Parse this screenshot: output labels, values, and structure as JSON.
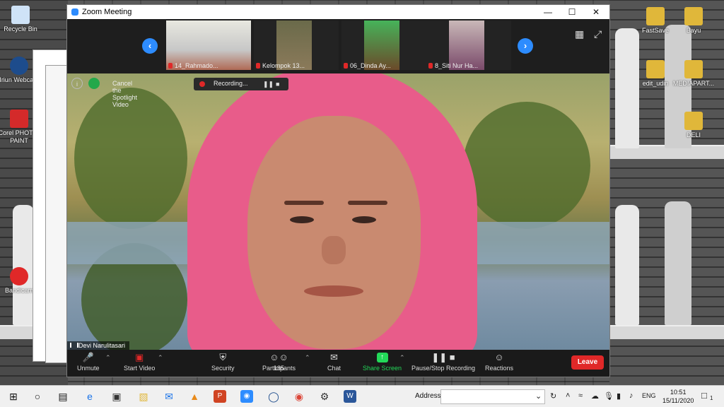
{
  "desktop": {
    "icons": [
      {
        "label": "Recycle Bin"
      },
      {
        "label": "Iriun Webcam"
      },
      {
        "label": "Corel PHOTO-PAINT"
      },
      {
        "label": "Bandicam"
      },
      {
        "label": "FastSave"
      },
      {
        "label": "Bayu"
      },
      {
        "label": "edit_udin"
      },
      {
        "label": "MEDIAPART..."
      },
      {
        "label": "DELI"
      }
    ]
  },
  "zoom": {
    "window_title": "Zoom Meeting",
    "participants": [
      {
        "name": "14_Rahmado..."
      },
      {
        "name": "Kelompok 13..."
      },
      {
        "name": "06_Dinda Ay..."
      },
      {
        "name": "8_Siti Nur Ha..."
      }
    ],
    "spotlight_label": "Cancel the Spotlight Video",
    "recording_label": "Recording...",
    "active_speaker": "Devi Narulitasari",
    "toolbar": {
      "unmute": "Unmute",
      "start_video": "Start Video",
      "security": "Security",
      "participants": "Participants",
      "participants_count": "185",
      "chat": "Chat",
      "share_screen": "Share Screen",
      "pause_stop": "Pause/Stop Recording",
      "reactions": "Reactions",
      "leave": "Leave"
    },
    "colors": {
      "accent": "#2d8cff",
      "leave": "#e02828",
      "share": "#23d959"
    }
  },
  "taskbar": {
    "address_label": "Address",
    "lang": "ENG",
    "time": "10:51",
    "date": "15/11/2020",
    "notification_count": "1"
  }
}
